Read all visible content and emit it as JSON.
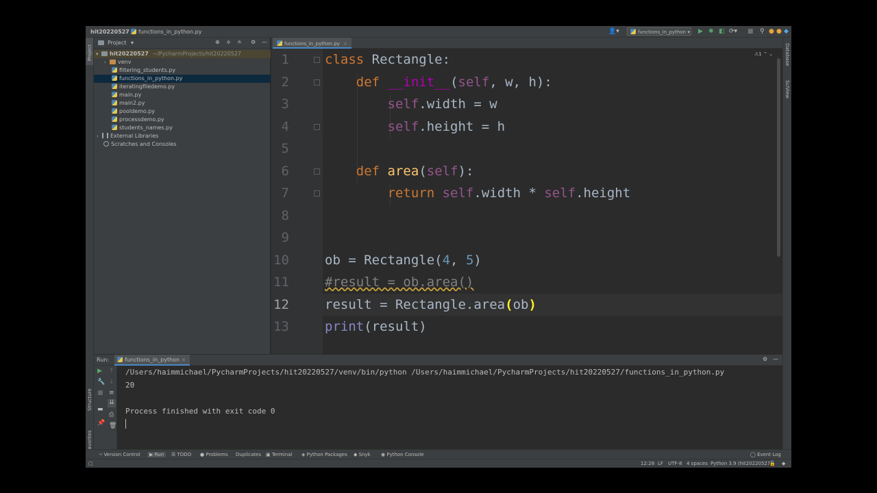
{
  "navbar": {
    "project_name": "hit20220527",
    "file_name": "functions_in_python.py",
    "run_config": "functions_in_python"
  },
  "project_panel": {
    "title": "Project",
    "root_name": "hit20220527",
    "root_path": "~/PycharmProjects/hit20220527",
    "items": [
      {
        "label": "venv",
        "type": "folder"
      },
      {
        "label": "filtering_students.py",
        "type": "py"
      },
      {
        "label": "functions_in_python.py",
        "type": "py",
        "selected": true
      },
      {
        "label": "iteratingfiledemo.py",
        "type": "py"
      },
      {
        "label": "main.py",
        "type": "py"
      },
      {
        "label": "main2.py",
        "type": "py"
      },
      {
        "label": "pooldemo.py",
        "type": "py"
      },
      {
        "label": "processdemo.py",
        "type": "py"
      },
      {
        "label": "students_names.py",
        "type": "py"
      }
    ],
    "external_libraries": "External Libraries",
    "scratches": "Scratches and Consoles"
  },
  "editor": {
    "tab_label": "functions_in_python.py",
    "warning_count": "1",
    "line_numbers": [
      "1",
      "2",
      "3",
      "4",
      "5",
      "6",
      "7",
      "8",
      "9",
      "10",
      "11",
      "12",
      "13"
    ],
    "current_line": "12"
  },
  "stripes": {
    "left_top": "Project",
    "left_structure": "Structure",
    "left_favorites": "Favorites",
    "right_database": "Database",
    "right_sciview": "SciView"
  },
  "run_panel": {
    "label": "Run:",
    "config": "functions_in_python",
    "output": [
      "/Users/haimmichael/PycharmProjects/hit20220527/venv/bin/python /Users/haimmichael/PycharmProjects/hit20220527/functions_in_python.py",
      "20",
      "",
      "Process finished with exit code 0"
    ]
  },
  "tool_windows": {
    "version_control": "Version Control",
    "run": "Run",
    "todo": "TODO",
    "problems": "Problems",
    "duplicates": "Duplicates",
    "terminal": "Terminal",
    "python_packages": "Python Packages",
    "snyk": "Snyk",
    "python_console": "Python Console",
    "event_log": "Event Log"
  },
  "status_bar": {
    "position": "12:28",
    "line_sep": "LF",
    "encoding": "UTF-8",
    "indent": "4 spaces",
    "interpreter": "Python 3.9 (hit20220527)"
  },
  "icons": [
    "gear-icon",
    "minimize-icon",
    "play-icon",
    "debug-icon",
    "search-icon",
    "folder-icon",
    "python-file-icon",
    "wrench-icon",
    "stop-icon"
  ]
}
